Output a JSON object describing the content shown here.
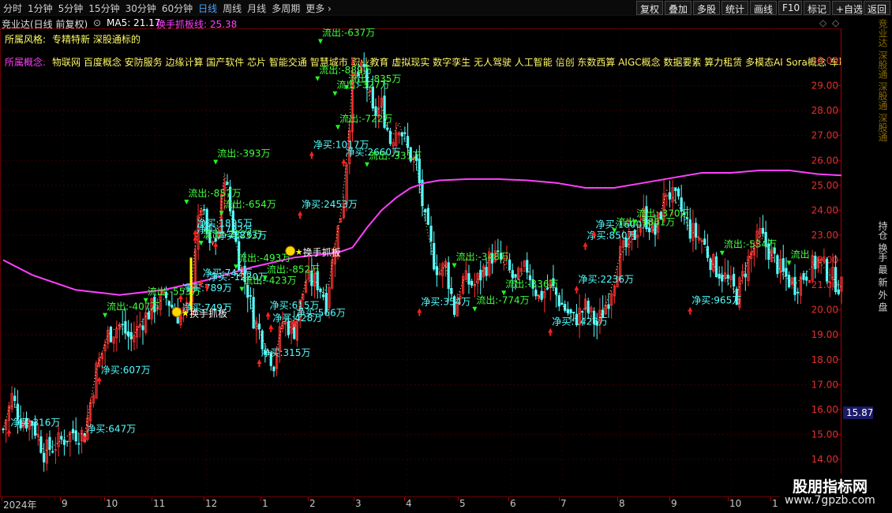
{
  "toolbar": {
    "periods": [
      "分时",
      "1分钟",
      "5分钟",
      "15分钟",
      "30分钟",
      "60分钟",
      "日线",
      "周线",
      "月线",
      "多周期",
      "更多"
    ],
    "active_period": "日线",
    "buttons": [
      "复权",
      "叠加",
      "多股",
      "统计",
      "画线",
      "F10",
      "标记",
      "+自选",
      "返回"
    ]
  },
  "info": {
    "title": "竞业达(日线 前复权)",
    "ma_label": "MA5: 21.17",
    "indicator_label": "换手抓板线: 25.38",
    "ma_color": "#ffffff",
    "indicator_color": "#ff40ff"
  },
  "styles": {
    "style_label": "所属风格:",
    "style_value": "专精特新 深股通标的",
    "concept_label": "所属概念:",
    "concept_value": "物联网 百度概念 安防服务 边缘计算 国产软件 芯片 智能交通 智慧城市 职业教育 虚拟现实 数字孪生 无人驾驶 人工智能 信创 东数西算 AIGC概念 数据要素 算力租赁 多模态AI Sora概念 车联网"
  },
  "side_panel": {
    "top": "竞业达 深股通 深股通 深股通",
    "bottom": "持仓 换手 最 新 外 盘"
  },
  "watermark": {
    "name": "股朋指标网",
    "url": "www.7gpzb.com"
  },
  "chart_data": {
    "type": "candlestick",
    "title": "竞业达(日线 前复权)",
    "ylim": [
      14,
      31
    ],
    "yticks": [
      "14.00",
      "15.00",
      "16.00",
      "17.00",
      "18.00",
      "19.00",
      "20.00",
      "21.00",
      "22.00",
      "23.00",
      "24.00",
      "25.00",
      "26.00",
      "27.00",
      "28.00",
      "29.00",
      "30.00"
    ],
    "current_price": "15.87",
    "x_range_days": [
      0,
      224
    ],
    "date_ticks": [
      {
        "label": "2024年",
        "day": 0
      },
      {
        "label": "9",
        "day": 16
      },
      {
        "label": "10",
        "day": 28
      },
      {
        "label": "11",
        "day": 46
      },
      {
        "label": "12",
        "day": 64
      },
      {
        "label": "1",
        "day": 82
      },
      {
        "label": "2",
        "day": 100
      },
      {
        "label": "3",
        "day": 118
      },
      {
        "label": "4",
        "day": 136
      },
      {
        "label": "5",
        "day": 156
      },
      {
        "label": "6",
        "day": 172
      },
      {
        "label": "7",
        "day": 190
      },
      {
        "label": "8",
        "day": 208
      },
      {
        "label": "9",
        "day": 224
      },
      {
        "label": "10",
        "day": 238
      },
      {
        "label": "1",
        "day": 258
      }
    ],
    "price_path": [
      [
        0,
        15.2
      ],
      [
        3,
        16.5
      ],
      [
        6,
        15.6
      ],
      [
        10,
        15.5
      ],
      [
        14,
        14.3
      ],
      [
        18,
        14.6
      ],
      [
        24,
        15.1
      ],
      [
        28,
        15.0
      ],
      [
        32,
        17.6
      ],
      [
        36,
        19.0
      ],
      [
        40,
        19.4
      ],
      [
        44,
        18.8
      ],
      [
        48,
        19.6
      ],
      [
        52,
        20.2
      ],
      [
        56,
        20.5
      ],
      [
        60,
        19.8
      ],
      [
        64,
        20.0
      ],
      [
        66,
        22.6
      ],
      [
        68,
        24.2
      ],
      [
        71,
        22.4
      ],
      [
        74,
        23.1
      ],
      [
        76,
        25.5
      ],
      [
        78,
        24.0
      ],
      [
        81,
        22.0
      ],
      [
        84,
        20.8
      ],
      [
        86,
        19.7
      ],
      [
        90,
        18.6
      ],
      [
        93,
        17.9
      ],
      [
        96,
        19.5
      ],
      [
        100,
        19.2
      ],
      [
        104,
        21.2
      ],
      [
        108,
        21.1
      ],
      [
        111,
        20.4
      ],
      [
        114,
        22.6
      ],
      [
        117,
        24.5
      ],
      [
        120,
        29.2
      ],
      [
        124,
        29.6
      ],
      [
        127,
        27.8
      ],
      [
        130,
        28.2
      ],
      [
        133,
        26.8
      ],
      [
        136,
        27.5
      ],
      [
        139,
        26.4
      ],
      [
        142,
        25.8
      ],
      [
        145,
        23.5
      ],
      [
        148,
        22.0
      ],
      [
        150,
        21.5
      ],
      [
        152,
        21.8
      ],
      [
        155,
        20.0
      ],
      [
        158,
        21.2
      ],
      [
        162,
        21.0
      ],
      [
        165,
        21.6
      ],
      [
        168,
        22.2
      ],
      [
        172,
        21.9
      ],
      [
        176,
        21.1
      ],
      [
        180,
        21.7
      ],
      [
        184,
        20.5
      ],
      [
        188,
        21.0
      ],
      [
        192,
        20.2
      ],
      [
        196,
        19.6
      ],
      [
        200,
        20.1
      ],
      [
        204,
        19.4
      ],
      [
        208,
        20.5
      ],
      [
        212,
        22.2
      ],
      [
        216,
        22.8
      ],
      [
        220,
        23.8
      ],
      [
        224,
        23.1
      ],
      [
        228,
        24.8
      ],
      [
        232,
        24.2
      ],
      [
        236,
        23.2
      ],
      [
        240,
        22.8
      ],
      [
        244,
        21.8
      ],
      [
        248,
        21.3
      ],
      [
        252,
        20.6
      ],
      [
        256,
        22.0
      ],
      [
        260,
        23.0
      ],
      [
        264,
        22.2
      ],
      [
        268,
        21.4
      ],
      [
        272,
        21.0
      ],
      [
        276,
        21.5
      ],
      [
        280,
        22.0
      ],
      [
        284,
        21.4
      ],
      [
        288,
        20.9
      ]
    ],
    "series": [
      {
        "name": "换手抓板线",
        "color": "#ff40ff",
        "points": [
          [
            0,
            22.0
          ],
          [
            10,
            21.4
          ],
          [
            25,
            20.8
          ],
          [
            40,
            20.6
          ],
          [
            55,
            20.8
          ],
          [
            70,
            21.2
          ],
          [
            85,
            21.7
          ],
          [
            100,
            22.1
          ],
          [
            115,
            22.3
          ],
          [
            120,
            22.5
          ],
          [
            125,
            23.3
          ],
          [
            130,
            24.0
          ],
          [
            135,
            24.5
          ],
          [
            140,
            24.9
          ],
          [
            145,
            25.1
          ],
          [
            150,
            25.2
          ],
          [
            160,
            25.25
          ],
          [
            170,
            25.25
          ],
          [
            180,
            25.2
          ],
          [
            190,
            25.1
          ],
          [
            200,
            24.9
          ],
          [
            210,
            24.9
          ],
          [
            220,
            25.1
          ],
          [
            230,
            25.3
          ],
          [
            240,
            25.5
          ],
          [
            250,
            25.5
          ],
          [
            260,
            25.6
          ],
          [
            270,
            25.6
          ],
          [
            280,
            25.45
          ],
          [
            288,
            25.4
          ]
        ]
      }
    ],
    "annotations": [
      {
        "text": "净买:316万",
        "day": 2,
        "price": 15.35,
        "kind": "buy"
      },
      {
        "text": "净买:647万",
        "day": 28,
        "price": 15.1,
        "kind": "buy"
      },
      {
        "text": "净买:607万",
        "day": 33,
        "price": 17.45,
        "kind": "buy"
      },
      {
        "text": "流出:-407万",
        "day": 35,
        "price": 20.0,
        "kind": "sell"
      },
      {
        "text": "流出:-553万",
        "day": 49,
        "price": 20.6,
        "kind": "sell"
      },
      {
        "text": "净买:749万",
        "day": 61,
        "price": 19.95,
        "kind": "buy"
      },
      {
        "text": "净买:789万",
        "day": 61,
        "price": 20.75,
        "kind": "buy"
      },
      {
        "text": "流出:-857万",
        "day": 63,
        "price": 24.55,
        "kind": "sell"
      },
      {
        "text": "净买:1895万",
        "day": 66,
        "price": 23.35,
        "kind": "buy"
      },
      {
        "text": "净买:1722万",
        "day": 66,
        "price": 23.1,
        "kind": "buy"
      },
      {
        "text": "流出:-2226万",
        "day": 68,
        "price": 22.9,
        "kind": "sell"
      },
      {
        "text": "净买:742万",
        "day": 68,
        "price": 21.35,
        "kind": "buy"
      },
      {
        "text": "净买:833万",
        "day": 73,
        "price": 22.85,
        "kind": "buy"
      },
      {
        "text": "流出:-393万",
        "day": 73,
        "price": 26.15,
        "kind": "sell"
      },
      {
        "text": "流出:-654万",
        "day": 75,
        "price": 24.1,
        "kind": "sell"
      },
      {
        "text": "净买:-1220万",
        "day": 70,
        "price": 21.2,
        "kind": "buy"
      },
      {
        "text": "流出:-493万",
        "day": 80,
        "price": 21.95,
        "kind": "sell"
      },
      {
        "text": "流出:-423万",
        "day": 82,
        "price": 21.05,
        "kind": "sell"
      },
      {
        "text": "流出:-852万",
        "day": 90,
        "price": 21.5,
        "kind": "sell"
      },
      {
        "text": "净买:315万",
        "day": 88,
        "price": 18.15,
        "kind": "buy"
      },
      {
        "text": "净买:615万",
        "day": 91,
        "price": 20.05,
        "kind": "buy"
      },
      {
        "text": "净买:428万",
        "day": 92,
        "price": 19.55,
        "kind": "buy"
      },
      {
        "text": "净买:566万",
        "day": 100,
        "price": 19.75,
        "kind": "buy"
      },
      {
        "text": "净买:2453万",
        "day": 102,
        "price": 24.1,
        "kind": "buy"
      },
      {
        "text": "流出:-637万",
        "day": 109,
        "price": 31.0,
        "kind": "sell"
      },
      {
        "text": "流出:-889万",
        "day": 108,
        "price": 29.5,
        "kind": "sell"
      },
      {
        "text": "流出:-835万",
        "day": 118,
        "price": 29.15,
        "kind": "sell"
      },
      {
        "text": "流出:-327万",
        "day": 114,
        "price": 28.9,
        "kind": "sell"
      },
      {
        "text": "流出:-722万",
        "day": 115,
        "price": 27.55,
        "kind": "sell"
      },
      {
        "text": "净买:1017万",
        "day": 106,
        "price": 26.5,
        "kind": "buy"
      },
      {
        "text": "净买:2660万",
        "day": 117,
        "price": 26.2,
        "kind": "buy"
      },
      {
        "text": "流出:-331万",
        "day": 125,
        "price": 26.05,
        "kind": "sell"
      },
      {
        "text": "净买:354万",
        "day": 143,
        "price": 20.2,
        "kind": "buy"
      },
      {
        "text": "流出:-348万",
        "day": 155,
        "price": 22.0,
        "kind": "sell"
      },
      {
        "text": "流出:-774万",
        "day": 162,
        "price": 20.25,
        "kind": "sell"
      },
      {
        "text": "流出:-336万",
        "day": 172,
        "price": 20.9,
        "kind": "sell"
      },
      {
        "text": "净买:1428万",
        "day": 188,
        "price": 19.4,
        "kind": "buy"
      },
      {
        "text": "净买:2236万",
        "day": 197,
        "price": 21.1,
        "kind": "buy"
      },
      {
        "text": "净买:850万",
        "day": 200,
        "price": 22.85,
        "kind": "buy"
      },
      {
        "text": "净买:1600万",
        "day": 203,
        "price": 23.3,
        "kind": "buy"
      },
      {
        "text": "流出:-1861万",
        "day": 210,
        "price": 23.4,
        "kind": "sell"
      },
      {
        "text": "流出:-370万",
        "day": 217,
        "price": 23.75,
        "kind": "sell"
      },
      {
        "text": "净买:965万",
        "day": 236,
        "price": 20.25,
        "kind": "buy"
      },
      {
        "text": "流出:-534万",
        "day": 247,
        "price": 22.5,
        "kind": "sell"
      },
      {
        "text": "流出",
        "day": 270,
        "price": 22.1,
        "kind": "sell"
      }
    ],
    "markers": [
      {
        "text": "换手抓板",
        "day": 61,
        "price": 19.85
      },
      {
        "text": "换手抓板",
        "day": 100,
        "price": 22.3
      }
    ]
  }
}
